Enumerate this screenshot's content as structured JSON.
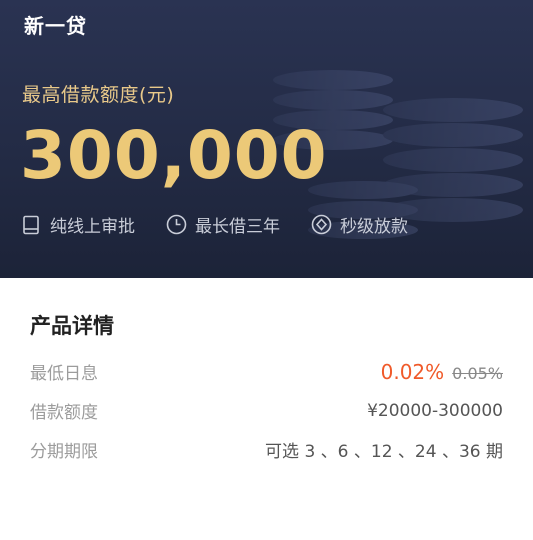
{
  "app": {
    "title": "新一贷"
  },
  "hero": {
    "amount_label": "最高借款额度(元)",
    "amount": "300,000",
    "features": [
      {
        "icon": "tablet-icon",
        "label": "纯线上审批"
      },
      {
        "icon": "clock-icon",
        "label": "最长借三年"
      },
      {
        "icon": "coin-icon",
        "label": "秒级放款"
      }
    ]
  },
  "details": {
    "title": "产品详情",
    "rows": [
      {
        "label": "最低日息",
        "value_current": "0.02%",
        "value_old": "0.05%"
      },
      {
        "label": "借款额度",
        "value": "¥20000-300000"
      },
      {
        "label": "分期期限",
        "value": "可选 3 、6 、12 、24 、36 期"
      }
    ]
  },
  "colors": {
    "hero_bg": "#232b45",
    "gold": "#ecc978",
    "rate_highlight": "#f05a2a"
  }
}
